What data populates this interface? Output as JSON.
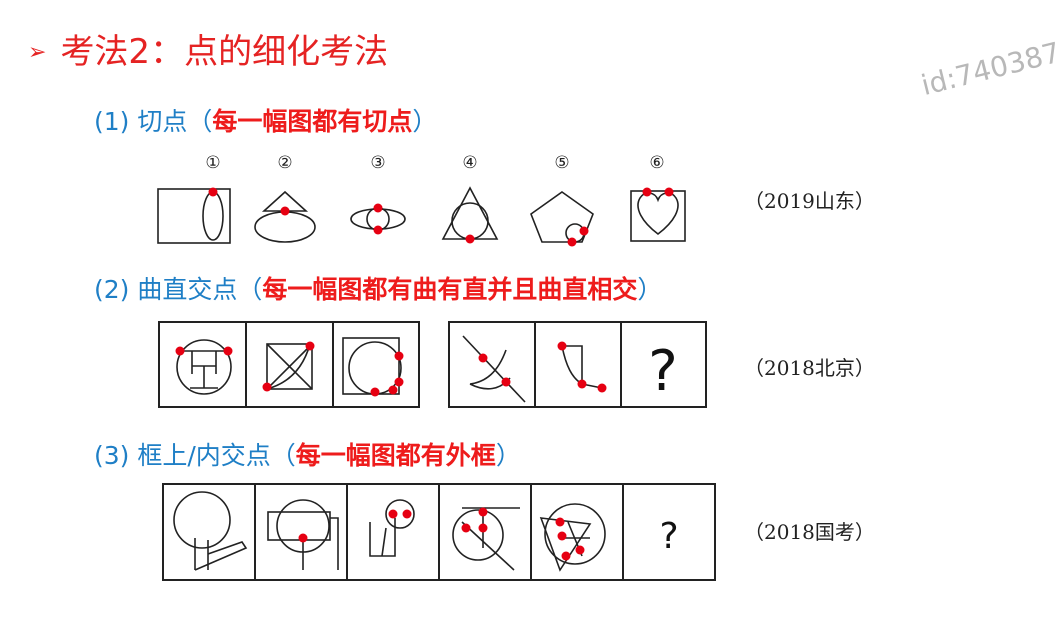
{
  "title": {
    "arrow": "➢",
    "text": "考法2：点的细化考法"
  },
  "watermark": "id:740387",
  "sections": [
    {
      "prefix": "(1) 切点（",
      "highlight": "每一幅图都有切点",
      "suffix": "）",
      "source": "（2019山东）",
      "numbers": [
        "①",
        "②",
        "③",
        "④",
        "⑤",
        "⑥"
      ]
    },
    {
      "prefix": "(2) 曲直交点（",
      "highlight": "每一幅图都有曲有直并且曲直相交",
      "suffix": "）",
      "source": "（2018北京）",
      "question": "?"
    },
    {
      "prefix": "(3) 框上/内交点（",
      "highlight": "每一幅图都有外框",
      "suffix": "）",
      "source": "（2018国考）",
      "question": "?"
    }
  ],
  "colors": {
    "accent_red": "#ee1c1c",
    "subtitle_blue": "#1f7fc6",
    "dot_red": "#e60012"
  }
}
